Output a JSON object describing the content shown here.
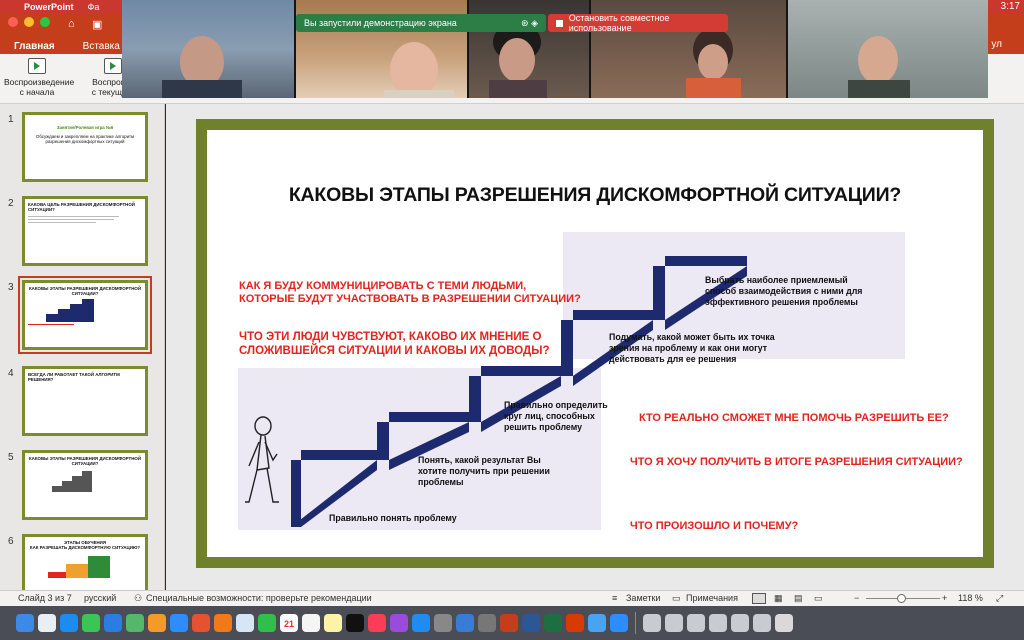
{
  "menubar": {
    "app": "PowerPoint",
    "file_menu": "Фа",
    "clock": "3:17"
  },
  "ribbon": {
    "tabs": [
      "Главная",
      "Вставка"
    ],
    "right_tab": "ул",
    "buttons": [
      {
        "label": "Воспроизведение\nс начала"
      },
      {
        "label": "Воспроизв\nс текущего"
      }
    ]
  },
  "zoom": {
    "share_banner": "Вы запустили демонстрацию экрана",
    "stop_share": "Остановить совместное использование"
  },
  "thumbnails": [
    {
      "num": "1",
      "line1": "Занятие/Ролевая игра №6",
      "line2": "Обсуждаем и закрепляем на практике алгоритм разрешения дискомфортных ситуаций"
    },
    {
      "num": "2",
      "title": "КАКОВА ЦЕЛЬ РАЗРЕШЕНИЯ ДИСКОМФОРТНОЙ СИТУАЦИИ?"
    },
    {
      "num": "3",
      "title": "КАКОВЫ ЭТАПЫ РАЗРЕШЕНИЯ ДИСКОМФОРТНОЙ СИТУАЦИИ?"
    },
    {
      "num": "4",
      "title": "ВСЕГДА ЛИ РАБОТАЕТ ТАКОЙ АЛГОРИТМ РЕШЕНИЯ?"
    },
    {
      "num": "5",
      "title": "КАКОВЫ ЭТАПЫ РАЗРЕШЕНИЯ ДИСКОМФОРТНОЙ СИТУАЦИИ?"
    },
    {
      "num": "6",
      "title": "ЭТАПЫ ОБУЧЕНИЯ\nКАК РАЗРЕШАТЬ ДИСКОМФОРТНУЮ СИТУАЦИЮ?"
    }
  ],
  "slide": {
    "title": "КАКОВЫ ЭТАПЫ РАЗРЕШЕНИЯ ДИСКОМФОРТНОЙ СИТУАЦИИ?",
    "questions_left": [
      "КАК Я БУДУ КОММУНИЦИРОВАТЬ С ТЕМИ ЛЮДЬМИ,\nКОТОРЫЕ БУДУТ УЧАСТВОВАТЬ В РАЗРЕШЕНИИ СИТУАЦИИ?",
      "ЧТО ЭТИ ЛЮДИ ЧУВСТВУЮТ, КАКОВО ИХ МНЕНИЕ О\nСЛОЖИВШЕЙСЯ СИТУАЦИИ И КАКОВЫ ИХ ДОВОДЫ?"
    ],
    "questions_right": [
      "КТО РЕАЛЬНО СМОЖЕТ МНЕ ПОМОЧЬ РАЗРЕШИТЬ ЕЕ?",
      "ЧТО Я ХОЧУ ПОЛУЧИТЬ В ИТОГЕ РАЗРЕШЕНИЯ СИТУАЦИИ?",
      "ЧТО ПРОИЗОШЛО И ПОЧЕМУ?"
    ],
    "steps": [
      "Правильно понять проблему",
      "Понять, какой результат Вы\nхотите получить при решении\nпроблемы",
      "Правильно определить\nкруг лиц, способных\nрешить проблему",
      "Подумать, какой может быть их точка\nзрения на проблему и как они могут\nдействовать для ее решения",
      "Выбрать наиболее приемлемый\nспособ взаимодействия с ними для\nэффективного решения проблемы"
    ]
  },
  "status": {
    "slide": "Слайд 3 из 7",
    "lang": "русский",
    "accessibility": "Специальные возможности: проверьте рекомендации",
    "notes": "Заметки",
    "comments": "Примечания",
    "zoom": "118 %",
    "calendar_day": "21"
  },
  "colors": {
    "accent": "#c43e1c",
    "slide_border": "#71802b",
    "question_red": "#e3231e",
    "stair_navy": "#1e2a6e"
  }
}
